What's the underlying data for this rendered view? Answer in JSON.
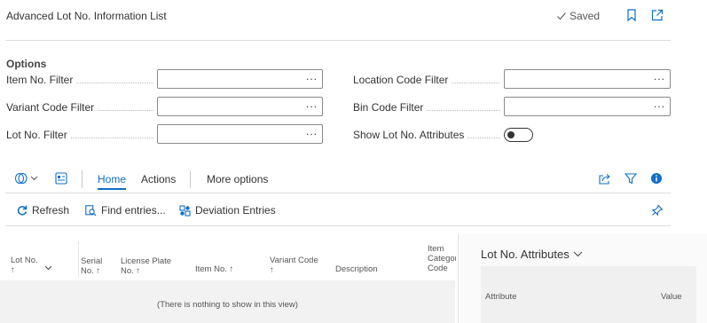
{
  "header": {
    "title": "Advanced Lot No. Information List",
    "saved_label": "Saved"
  },
  "options": {
    "section_title": "Options",
    "fields": {
      "item_no_filter": {
        "label": "Item No. Filter",
        "value": "",
        "lookup": "..."
      },
      "variant_code_filter": {
        "label": "Variant Code Filter",
        "value": "",
        "lookup": "..."
      },
      "lot_no_filter": {
        "label": "Lot No. Filter",
        "value": "",
        "lookup": "..."
      },
      "location_code_filter": {
        "label": "Location Code Filter",
        "value": "",
        "lookup": "..."
      },
      "bin_code_filter": {
        "label": "Bin Code Filter",
        "value": "",
        "lookup": "..."
      },
      "show_lot_no_attributes": {
        "label": "Show Lot No. Attributes",
        "checked": false
      }
    }
  },
  "menu": {
    "home": "Home",
    "actions": "Actions",
    "more_options": "More options"
  },
  "action_bar": {
    "refresh": "Refresh",
    "find_entries": "Find entries...",
    "deviation_entries": "Deviation Entries"
  },
  "grid": {
    "columns": {
      "lot_no": "Lot No.",
      "lot_no_sort": "↑",
      "serial_no_line1": "Serial",
      "serial_no_line2": "No. ↑",
      "license_plate_line1": "License Plate",
      "license_plate_line2": "No. ↑",
      "item_no": "Item No. ↑",
      "variant_code": "Variant Code",
      "variant_code_sort": "↑",
      "description": "Description",
      "item_category_line1": "Item",
      "item_category_line2": "Categor",
      "item_category_line3": "Code"
    },
    "empty_message": "(There is nothing to show in this view)"
  },
  "factbox": {
    "title": "Lot No. Attributes",
    "columns": {
      "attribute": "Attribute",
      "value": "Value"
    }
  },
  "colors": {
    "accent": "#0f6fc6",
    "border": "#8a8a8a",
    "grid_bg": "#f2f2f2"
  }
}
